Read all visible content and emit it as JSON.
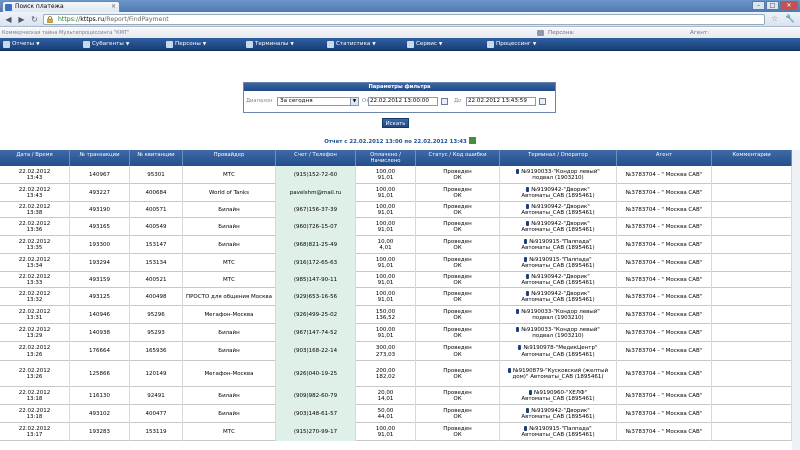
{
  "browser": {
    "tab_title": "Поиск платежа",
    "url_scheme": "https://",
    "url_host": "kttps.ru",
    "url_path": "/Report/FindPayment",
    "win_min": "–",
    "win_max": "□",
    "win_close": "✕",
    "tab_close": "×"
  },
  "app": {
    "company": "Коммерческая тайна Мультипроцессинга \"КМТ\"",
    "partner_label": "Персона:",
    "agent_label": "Агент:"
  },
  "menu": [
    {
      "label": "Отчеты"
    },
    {
      "label": "Субагенты"
    },
    {
      "label": "Персоны"
    },
    {
      "label": "Терминалы"
    },
    {
      "label": "Статистика"
    },
    {
      "label": "Сервис"
    },
    {
      "label": "Процессинг"
    }
  ],
  "filter": {
    "title": "Параметры фильтра",
    "range_label": "Диапазон",
    "range_value": "За сегодня",
    "from_label": "От",
    "from_value": "22.02.2012 13:00:00",
    "to_label": "До",
    "to_value": "22.02.2012 13:43:59",
    "search_button": "Искать"
  },
  "report_title": "Отчет с 22.02.2012 13:00 по 22.02.2012 13:43",
  "columns": [
    "Дата / Время",
    "№ транзакции",
    "№ квитанции",
    "Провайдер",
    "Счет / Телефон",
    "Оплачено / Начислено",
    "Статус / Код ошибки",
    "Терминал / Оператор",
    "Агент",
    "Комментарии"
  ],
  "rows": [
    {
      "date": "22.02.2012",
      "time": "13:43",
      "tx": "140967",
      "receipt": "95301",
      "provider": "МТС",
      "account": "(915)152-72-60",
      "paid": "100,00",
      "credited": "91,01",
      "status": "Проведен",
      "code": "ОК",
      "term1": "№9190033-\"Кондор левый\"",
      "term2": "подвал (1903210)",
      "agent": "№3783704 - \" Москва САВ\""
    },
    {
      "date": "22.02.2012",
      "time": "13:43",
      "tx": "493227",
      "receipt": "400684",
      "provider": "World of Tanks",
      "account": "pavelshm@mail.ru",
      "paid": "100,00",
      "credited": "91,01",
      "status": "Проведен",
      "code": "ОК",
      "term1": "№9190942-\"Дворик\"",
      "term2": "Автоматы_САВ (1895461)",
      "agent": "№3783704 - \" Москва САВ\""
    },
    {
      "date": "22.02.2012",
      "time": "13:38",
      "tx": "493190",
      "receipt": "400571",
      "provider": "Билайн",
      "account": "(967)156-37-39",
      "paid": "100,00",
      "credited": "91,01",
      "status": "Проведен",
      "code": "ОК",
      "term1": "№9190942-\"Дворик\"",
      "term2": "Автоматы_САВ (1895461)",
      "agent": "№3783704 - \" Москва САВ\""
    },
    {
      "date": "22.02.2012",
      "time": "13:36",
      "tx": "493165",
      "receipt": "400549",
      "provider": "Билайн",
      "account": "(960)726-15-07",
      "paid": "100,00",
      "credited": "91,01",
      "status": "Проведен",
      "code": "ОК",
      "term1": "№9190942-\"Дворик\"",
      "term2": "Автоматы_САВ (1895461)",
      "agent": "№3783704 - \" Москва САВ\""
    },
    {
      "date": "22.02.2012",
      "time": "13:35",
      "tx": "193300",
      "receipt": "153147",
      "provider": "Билайн",
      "account": "(968)821-25-49",
      "paid": "10,00",
      "credited": "4,01",
      "status": "Проведен",
      "code": "ОК",
      "term1": "№9190915-\"Палпада\"",
      "term2": "Автоматы_САВ (1895461)",
      "agent": "№3783704 - \" Москва САВ\""
    },
    {
      "date": "22.02.2012",
      "time": "13:34",
      "tx": "193294",
      "receipt": "153134",
      "provider": "МТС",
      "account": "(916)172-65-63",
      "paid": "100,00",
      "credited": "91,01",
      "status": "Проведен",
      "code": "ОК",
      "term1": "№9190915-\"Палпада\"",
      "term2": "Автоматы_САВ (1895461)",
      "agent": "№3783704 - \" Москва САВ\""
    },
    {
      "date": "22.02.2012",
      "time": "13:33",
      "tx": "493159",
      "receipt": "400521",
      "provider": "МТС",
      "account": "(985)147-90-11",
      "paid": "100,00",
      "credited": "91,01",
      "status": "Проведен",
      "code": "ОК",
      "term1": "№9190942-\"Дворик\"",
      "term2": "Автоматы_САВ (1895461)",
      "agent": "№3783704 - \" Москва САВ\""
    },
    {
      "date": "22.02.2012",
      "time": "13:32",
      "tx": "493125",
      "receipt": "400498",
      "provider": "ПРОСТО для общения Москва",
      "account": "(929)653-16-56",
      "paid": "100,00",
      "credited": "91,01",
      "status": "Проведен",
      "code": "ОК",
      "term1": "№9190942-\"Дворик\"",
      "term2": "Автоматы_САВ (1895461)",
      "agent": "№3783704 - \" Москва САВ\""
    },
    {
      "date": "22.02.2012",
      "time": "13:31",
      "tx": "140946",
      "receipt": "95296",
      "provider": "Мегафон-Москва",
      "account": "(926)499-25-02",
      "paid": "150,00",
      "credited": "136,52",
      "status": "Проведен",
      "code": "ОК",
      "term1": "№9190033-\"Кондор левый\"",
      "term2": "подвал (1903210)",
      "agent": "№3783704 - \" Москва САВ\""
    },
    {
      "date": "22.02.2012",
      "time": "13:29",
      "tx": "140938",
      "receipt": "95293",
      "provider": "Билайн",
      "account": "(967)147-74-52",
      "paid": "100,00",
      "credited": "91,01",
      "status": "Проведен",
      "code": "ОК",
      "term1": "№9190033-\"Кондор левый\"",
      "term2": "подвал (1903210)",
      "agent": "№3783704 - \" Москва САВ\""
    },
    {
      "date": "22.02.2012",
      "time": "13:26",
      "tx": "176664",
      "receipt": "165936",
      "provider": "Билайн",
      "account": "(903)168-22-14",
      "paid": "300,00",
      "credited": "273,03",
      "status": "Проведен",
      "code": "ОК",
      "term1": "№9190978-\"МедикЦентр\"",
      "term2": "Автоматы_САВ (1895461)",
      "agent": "№3783704 - \" Москва САВ\""
    },
    {
      "date": "22.02.2012",
      "time": "13:26",
      "tx": "125866",
      "receipt": "120149",
      "provider": "Мегафон-Москва",
      "account": "(926)040-19-25",
      "paid": "200,00",
      "credited": "182,02",
      "status": "Проведен",
      "code": "ОК",
      "term1": "№9190879-\"Кусковский (желтый",
      "term2": "дом)\" Автоматы_САВ (1895461)",
      "agent": "№3783704 - \" Москва САВ\""
    },
    {
      "date": "22.02.2012",
      "time": "13:18",
      "tx": "116130",
      "receipt": "92491",
      "provider": "Билайн",
      "account": "(909)982-60-79",
      "paid": "20,00",
      "credited": "14,01",
      "status": "Проведен",
      "code": "ОК",
      "term1": "№9190960-\"ХЕЛФ\"",
      "term2": "Автоматы_САВ (1895461)",
      "agent": "№3783704 - \" Москва САВ\""
    },
    {
      "date": "22.02.2012",
      "time": "13:18",
      "tx": "493102",
      "receipt": "400477",
      "provider": "Билайн",
      "account": "(903)148-61-57",
      "paid": "50,00",
      "credited": "44,01",
      "status": "Проведен",
      "code": "ОК",
      "term1": "№9190942-\"Дворик\"",
      "term2": "Автоматы_САВ (1895461)",
      "agent": "№3783704 - \" Москва САВ\""
    },
    {
      "date": "22.02.2012",
      "time": "13:17",
      "tx": "193283",
      "receipt": "153119",
      "provider": "МТС",
      "account": "(915)270-99-17",
      "paid": "100,00",
      "credited": "91,01",
      "status": "Проведен",
      "code": "ОК",
      "term1": "№9190915-\"Палпада\"",
      "term2": "Автоматы_САВ (1895461)",
      "agent": "№3783704 - \" Москва САВ\""
    }
  ]
}
